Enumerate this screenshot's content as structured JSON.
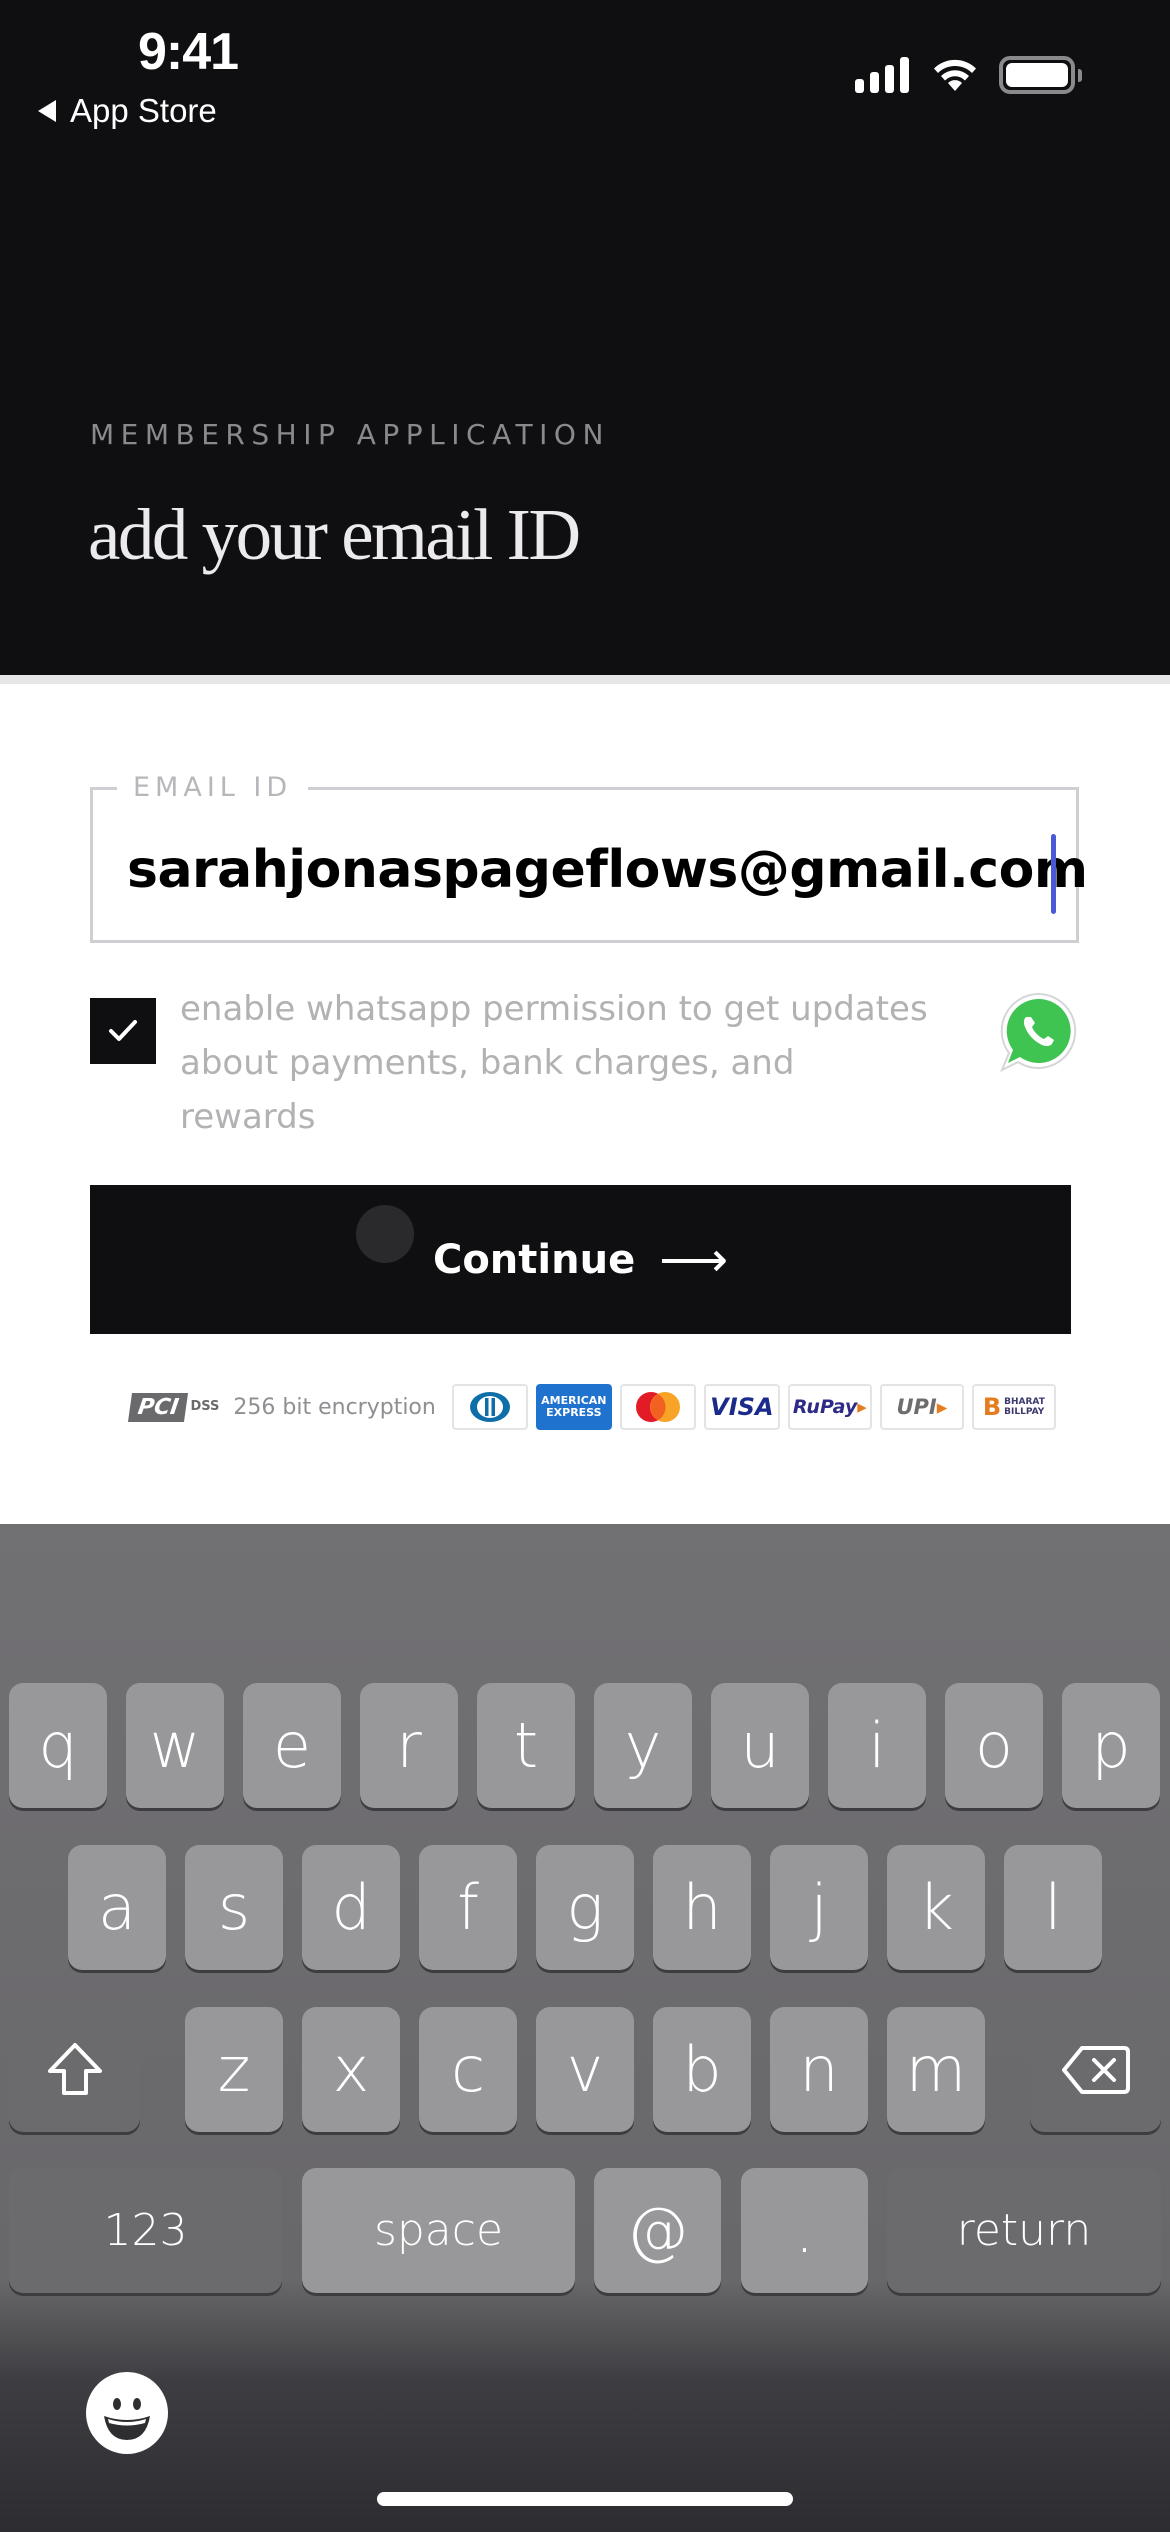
{
  "status_bar": {
    "time": "9:41",
    "back_label": "App Store",
    "icons": [
      "signal-icon",
      "wifi-icon",
      "battery-icon"
    ]
  },
  "header": {
    "eyebrow": "MEMBERSHIP APPLICATION",
    "title": "add your email ID"
  },
  "form": {
    "email": {
      "label": "EMAIL ID",
      "value": "sarahjonaspageflows@gmail.com"
    },
    "whatsapp_consent": {
      "checked": true,
      "text": "enable whatsapp permission to get updates about payments, bank charges, and rewards",
      "icon": "whatsapp-icon"
    },
    "continue_label": "Continue",
    "continue_icon": "arrow-right-icon"
  },
  "security": {
    "pci_label": "PCI",
    "pci_sub": "DSS",
    "encryption_text": "256 bit encryption",
    "payment_methods": [
      "Diners Club",
      "American Express",
      "Mastercard",
      "VISA",
      "RuPay",
      "UPI",
      "Bharat BillPay"
    ],
    "amex_line1": "AMERICAN",
    "amex_line2": "EXPRESS",
    "visa_label": "VISA",
    "rupay_label": "RuPay",
    "upi_label": "UPI",
    "bbps_mark": "B",
    "bbps_line1": "BHARAT",
    "bbps_line2": "BILLPAY"
  },
  "keyboard": {
    "row1": [
      "q",
      "w",
      "e",
      "r",
      "t",
      "y",
      "u",
      "i",
      "o",
      "p"
    ],
    "row2": [
      "a",
      "s",
      "d",
      "f",
      "g",
      "h",
      "j",
      "k",
      "l"
    ],
    "row3": [
      "z",
      "x",
      "c",
      "v",
      "b",
      "n",
      "m"
    ],
    "numbers_label": "123",
    "space_label": "space",
    "at_label": "@",
    "dot_label": ".",
    "return_label": "return",
    "shift_icon": "shift-icon",
    "delete_icon": "backspace-icon",
    "emoji_icon": "emoji-icon"
  }
}
